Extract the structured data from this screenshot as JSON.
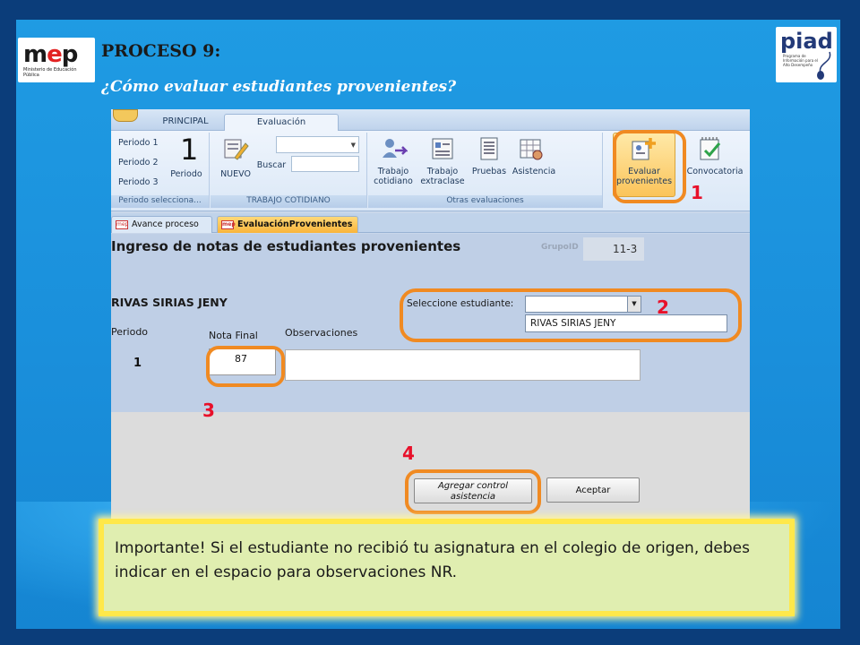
{
  "slide": {
    "title": "PROCESO 9:",
    "subtitle": "¿Cómo evaluar estudiantes provenientes?",
    "logo_left": {
      "name": "mep",
      "sub": "Ministerio de Educación Pública"
    },
    "logo_right": {
      "name": "piad",
      "sub": "Programa de Información para el Alto Desempeño"
    }
  },
  "ribbon": {
    "tabs": [
      "PRINCIPAL",
      "Evaluación"
    ],
    "active_tab": "Evaluación",
    "periodo_group": {
      "items": [
        "Periodo 1",
        "Periodo 2",
        "Periodo 3"
      ],
      "current": "1",
      "button_label": "Periodo",
      "group_label": "Periodo selecciona..."
    },
    "trabajo_group": {
      "nuevo_label": "NUEVO",
      "buscar_label": "Buscar",
      "group_label": "TRABAJO COTIDIANO"
    },
    "otras_group": {
      "buttons": [
        {
          "label_1": "Trabajo",
          "label_2": "cotidiano",
          "icon": "users-arrow-icon"
        },
        {
          "label_1": "Trabajo",
          "label_2": "extraclase",
          "icon": "form-icon"
        },
        {
          "label_1": "Pruebas",
          "label_2": "",
          "icon": "document-icon"
        },
        {
          "label_1": "Asistencia",
          "label_2": "",
          "icon": "attendance-grid-icon"
        }
      ],
      "group_label": "Otras evaluaciones"
    },
    "right_buttons": [
      {
        "label_1": "Evaluar",
        "label_2": "provenientes",
        "icon": "add-evaluation-icon"
      },
      {
        "label_1": "Convocatoria",
        "label_2": "",
        "icon": "notebook-check-icon"
      }
    ]
  },
  "doc_tabs": [
    "Avance proceso",
    "EvaluaciónProvenientes"
  ],
  "form": {
    "title": "Ingreso de notas de estudiantes provenientes",
    "grupo_label": "GrupoID",
    "grupo_value": "11-3",
    "student_name": "RIVAS SIRIAS JENY",
    "select_label": "Seleccione estudiante:",
    "select_option": "RIVAS SIRIAS JENY",
    "columns": {
      "periodo": "Periodo",
      "nota": "Nota Final",
      "obs": "Observaciones"
    },
    "row": {
      "periodo": "1",
      "nota": "87",
      "obs": ""
    },
    "btn_asistencia": "Agregar control asistencia",
    "btn_aceptar": "Aceptar"
  },
  "callouts": [
    "1",
    "2",
    "3",
    "4"
  ],
  "note": "Importante! Si el estudiante no recibió tu asignatura en el colegio de origen, debes indicar en el espacio para observaciones NR.",
  "colors": {
    "callout": "#f08a22",
    "number": "#e8102a",
    "slide_bg": "#1f9be3",
    "note_bg": "#e0eeb0"
  }
}
